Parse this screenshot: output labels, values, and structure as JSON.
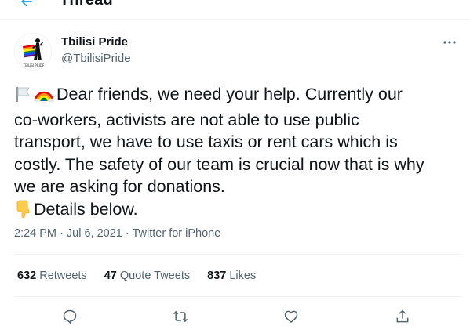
{
  "header": {
    "title": "Thread",
    "back_icon": "back-arrow-icon",
    "accent_color": "#1d9bf0"
  },
  "author": {
    "name": "Tbilisi Pride",
    "handle": "@TbilisiPride",
    "avatar_caption": "TBILISI PRIDE",
    "more_icon": "more-options-icon"
  },
  "tweet": {
    "lines": [
      "Dear friends, we need your help. Currently our",
      "co-workers, activists are not able to use public",
      "transport, we have to use taxis or rent cars which is",
      "costly. The safety of our team is crucial now that is why",
      "we are asking for donations.",
      "Details below."
    ],
    "emojis": [
      "white-flag-icon",
      "rainbow-icon",
      "pointing-down-icon"
    ]
  },
  "meta": {
    "time": "2:24 PM",
    "separator": " · ",
    "date": "Jul 6, 2021",
    "source": "Twitter for iPhone"
  },
  "stats": {
    "retweets_count": "632",
    "retweets_label": "Retweets",
    "quote_count": "47",
    "quote_label": "Quote Tweets",
    "likes_count": "837",
    "likes_label": "Likes"
  },
  "actions": [
    "reply-icon",
    "retweet-icon",
    "like-icon",
    "share-icon"
  ],
  "colors": {
    "text": "#0f1419",
    "secondary": "#536471",
    "divider": "#eff3f4"
  }
}
